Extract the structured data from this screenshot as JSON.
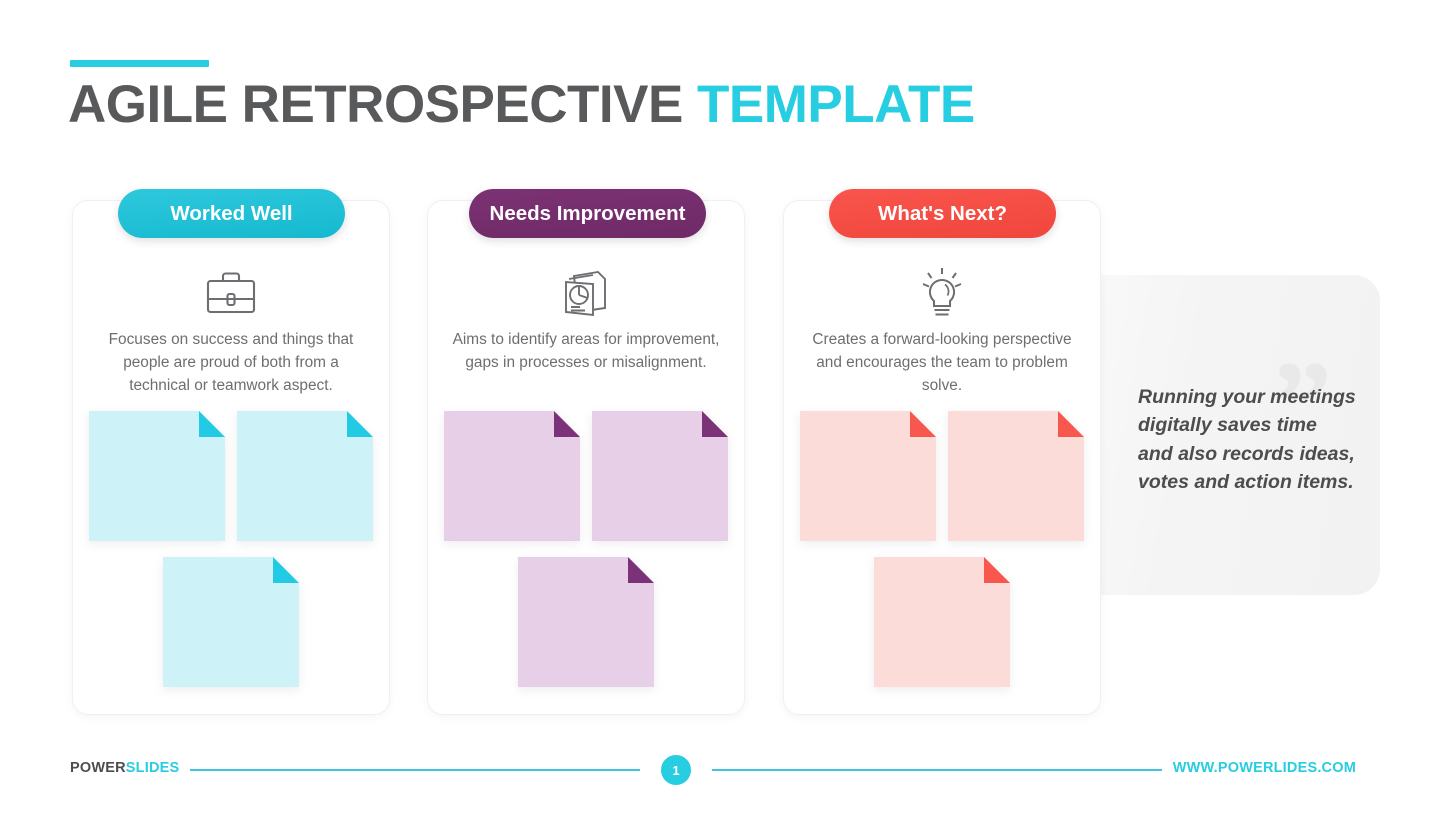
{
  "title": {
    "main": "AGILE RETROSPECTIVE ",
    "accent": "TEMPLATE"
  },
  "colors": {
    "cyan": "#27cde0",
    "purple": "#7c3274",
    "red": "#f9554c",
    "title_gray": "#58595b",
    "body_gray": "#6d6e71"
  },
  "columns": [
    {
      "header": "Worked Well",
      "icon": "briefcase-icon",
      "description": "Focuses on success and things that people are proud of both from a technical or teamwork aspect.",
      "note_color": "#cdf3f8",
      "fold_color": "#22cbe3",
      "note_rows": [
        2,
        1
      ]
    },
    {
      "header": "Needs Improvement",
      "icon": "report-chart-icon",
      "description": "Aims to identify areas for improvement, gaps in processes or misalignment.",
      "note_color": "#e8cfe8",
      "fold_color": "#7c3279",
      "note_rows": [
        2,
        1
      ]
    },
    {
      "header": "What's Next?",
      "icon": "lightbulb-icon",
      "description": "Creates a forward-looking perspective and encourages the team to problem solve.",
      "note_color": "#fcdcd8",
      "fold_color": "#f7574d",
      "note_rows": [
        2,
        1
      ]
    }
  ],
  "quote": {
    "mark": "”",
    "text": "Running your meetings digitally saves time and also records ideas, votes and action items."
  },
  "footer": {
    "logo_main": "POWER",
    "logo_accent": "SLIDES",
    "page_number": "1",
    "url": "WWW.POWERLIDES.COM"
  }
}
